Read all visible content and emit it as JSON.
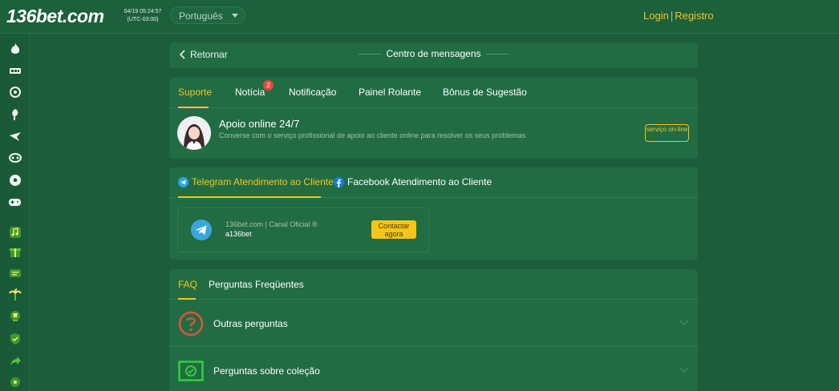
{
  "header": {
    "logo_main": "136",
    "logo_rest": "bet.com",
    "clock_date": "04/19 05:24:57",
    "clock_tz": "(UTC-03:00)",
    "language": "Português",
    "login": "Login",
    "separator": "|",
    "register": "Registro"
  },
  "sidebar": {
    "icons": [
      "fire-icon",
      "slots-icon",
      "poker-icon",
      "fishing-icon",
      "bird-icon",
      "cards-icon",
      "soccer-icon",
      "gamepad-icon",
      "music-icon",
      "gift-icon",
      "ticket-icon",
      "palm-icon",
      "trophy-icon",
      "shield-icon",
      "share-icon",
      "more-icon"
    ]
  },
  "nav": {
    "back_label": "Retornar",
    "title": "Centro de mensagens"
  },
  "message_tabs": {
    "items": [
      {
        "label": "Suporte",
        "active": true
      },
      {
        "label": "Notícia",
        "badge": "2"
      },
      {
        "label": "Notificação"
      },
      {
        "label": "Painel Rolante"
      },
      {
        "label": "Bônus de Sugestão"
      }
    ]
  },
  "support": {
    "title": "Apoio online 24/7",
    "description": "Converse com o serviço profissional de apoio ao cliente online para resolver os seus problemas",
    "button": "serviço on-line"
  },
  "contact_tabs": {
    "telegram": "Telegram Atendimento ao Cliente",
    "facebook": "Facebook Atendimento ao Cliente"
  },
  "telegram_channel": {
    "name": "136bet.com | Canal Oficial ®",
    "handle": "a136bet",
    "button": "Contactar agora"
  },
  "faq": {
    "tab_active": "FAQ",
    "tab_other": "Perguntas Freqüentes",
    "rows": [
      {
        "label": "Outras perguntas",
        "icon": "question-icon"
      },
      {
        "label": "Perguntas sobre coleção",
        "icon": "money-icon"
      }
    ]
  },
  "colors": {
    "background": "#1c5e3c",
    "card": "#226c44",
    "accent": "#f5c518",
    "badge": "#e64a3b"
  }
}
